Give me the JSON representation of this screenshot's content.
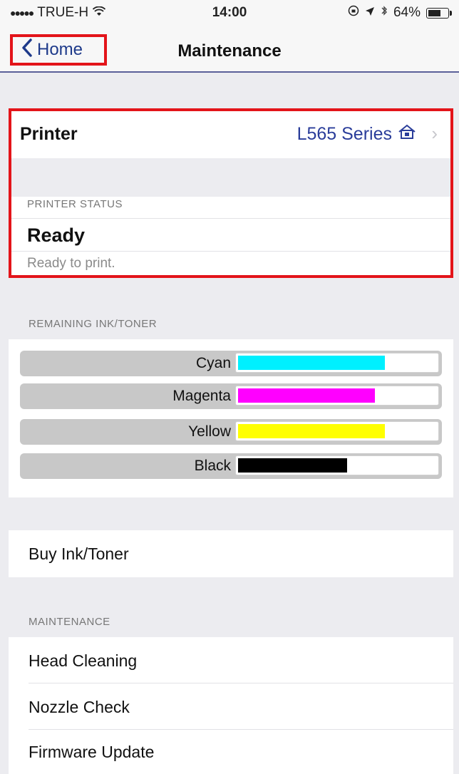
{
  "status_bar": {
    "carrier": "TRUE-H",
    "time": "14:00",
    "battery": "64%",
    "battery_level": 0.64
  },
  "nav": {
    "back_label": "Home",
    "title": "Maintenance"
  },
  "printer": {
    "label": "Printer",
    "value": "L565 Series",
    "status_header": "PRINTER STATUS",
    "status": "Ready",
    "status_detail": "Ready to print."
  },
  "ink": {
    "header": "REMAINING INK/TONER",
    "items": [
      {
        "name": "Cyan",
        "color": "#00f0ff",
        "level": 0.74
      },
      {
        "name": "Magenta",
        "color": "#ff00ff",
        "level": 0.69
      },
      {
        "name": "Yellow",
        "color": "#ffff00",
        "level": 0.74
      },
      {
        "name": "Black",
        "color": "#000000",
        "level": 0.55
      }
    ]
  },
  "buy": {
    "label": "Buy Ink/Toner"
  },
  "maintenance": {
    "header": "MAINTENANCE",
    "items": [
      "Head Cleaning",
      "Nozzle Check",
      "Firmware Update"
    ]
  },
  "colors": {
    "accent": "#2a3d9a",
    "highlight": "#e3141a"
  }
}
